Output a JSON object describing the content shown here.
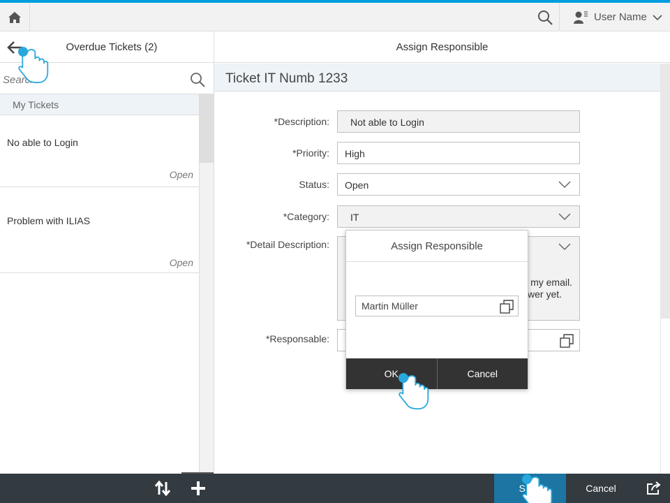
{
  "shell": {
    "user_name": "User Name",
    "icons": [
      "home-icon",
      "search-icon",
      "user-icon",
      "chevron-down-icon"
    ]
  },
  "master": {
    "title": "Overdue Tickets (2)",
    "search_placeholder": "Search",
    "group_header": "My Tickets",
    "items": [
      {
        "title": "No able to Login",
        "status": "Open"
      },
      {
        "title": "Problem with ILIAS",
        "status": "Open"
      }
    ]
  },
  "detail": {
    "header_title": "Assign Responsible",
    "ticket_title": "Ticket IT Numb 1233",
    "fields": {
      "description_label": "*Description:",
      "description_value": "Not able to Login",
      "priority_label": "*Priority:",
      "priority_value": "High",
      "status_label": "Status:",
      "status_value": "Open",
      "category_label": "*Category:",
      "category_value": "IT",
      "detail_label": "*Detail Description:",
      "detail_line1_fragment": "my email.",
      "detail_line2_fragment": "wer yet.",
      "responsable_label": "*Responsable:"
    }
  },
  "popup": {
    "title": "Assign Responsible",
    "input_value": "Martin Müller",
    "ok_label": "OK",
    "cancel_label": "Cancel"
  },
  "footer": {
    "save_label": "Save",
    "cancel_label": "Cancel",
    "icons": [
      "sort-icon",
      "add-icon",
      "share-icon"
    ]
  },
  "colors": {
    "accent": "#009de0",
    "save": "#1c75a3",
    "footer_bg": "#333a40",
    "tap_hint": "#2aa8dc"
  }
}
